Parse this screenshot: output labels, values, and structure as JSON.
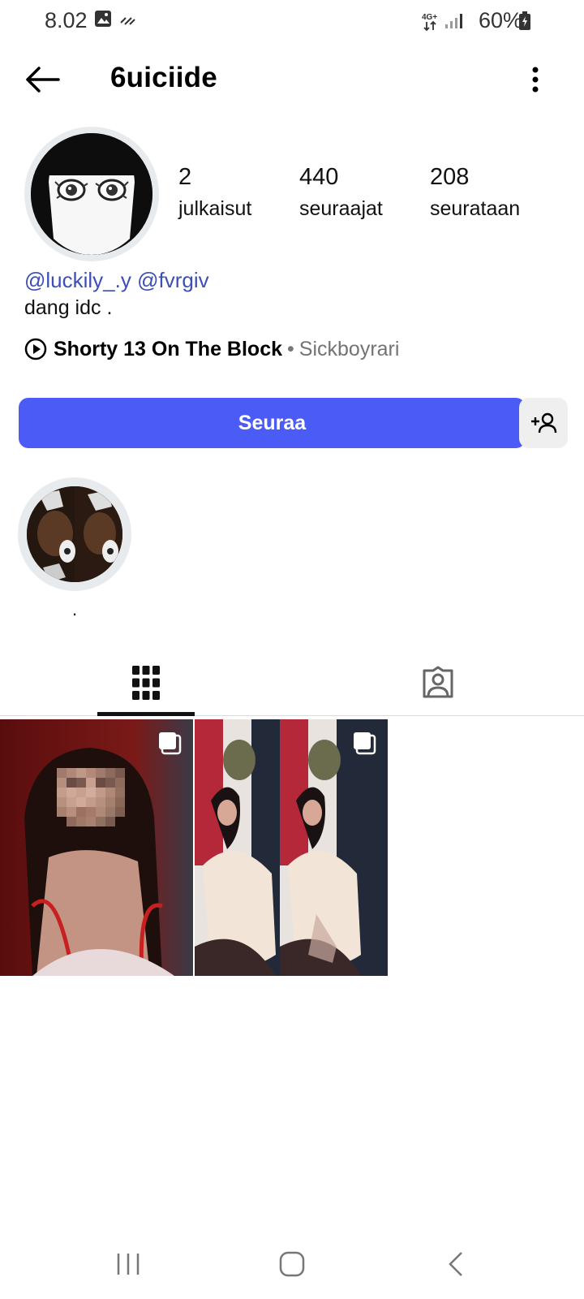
{
  "status_bar": {
    "time": "8.02",
    "battery": "60%",
    "network": "4G+"
  },
  "app_bar": {
    "username": "6uiciide"
  },
  "profile": {
    "stats": [
      {
        "value": "2",
        "label": "julkaisut"
      },
      {
        "value": "440",
        "label": "seuraajat"
      },
      {
        "value": "208",
        "label": "seurataan"
      }
    ],
    "mentions": [
      "@luckily_.y",
      "@fvrgiv"
    ],
    "bio": "dang idc .",
    "music": {
      "title": "Shorty 13 On The Block",
      "separator": "•",
      "artist": "Sickboyrari"
    }
  },
  "actions": {
    "follow_label": "Seuraa"
  },
  "highlights": [
    {
      "label": "."
    }
  ],
  "tabs": [
    {
      "icon": "grid-icon",
      "active": true
    },
    {
      "icon": "tagged-icon",
      "active": false
    }
  ],
  "colors": {
    "accent": "#4a5cf5",
    "mention": "#3d4fb7"
  }
}
